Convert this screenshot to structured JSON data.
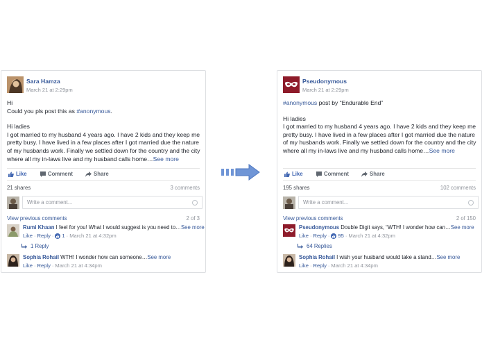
{
  "left_post": {
    "author": "Sara Hamza",
    "time": "March 21 at 2:29pm",
    "lines": [
      "Hi",
      "Could you pls post this as "
    ],
    "hashtag": "#anonymous",
    "period": ".",
    "greeting": "Hi ladies",
    "body": "I got married to my husband 4 years ago. I have 2 kids and they keep me pretty busy. I have lived in a few places after I got married due the nature of my husbands work. Finally we settled down for the country and the city where all my in-laws live and my husband calls home…",
    "see_more": "See more",
    "actions": {
      "like": "Like",
      "comment": "Comment",
      "share": "Share"
    },
    "shares": "21 shares",
    "comments_count": "3 comments",
    "comment_placeholder": "Write a comment...",
    "view_previous": "View previous comments",
    "page_count": "2 of 3",
    "comments": [
      {
        "author": "Rumi Khaan",
        "text": "I feel for you! What I would suggest is you need to…",
        "see_more": "See more",
        "like": "Like",
        "reply": "Reply",
        "likes": "1",
        "time": "March 21 at 4:32pm",
        "replies": "1 Reply"
      },
      {
        "author": "Sophia Rohail",
        "text": "WTH! I wonder how can someone…",
        "see_more": "See more",
        "like": "Like",
        "reply": "Reply",
        "time": "March 21 at 4:34pm"
      }
    ]
  },
  "right_post": {
    "author": "Pseudonymous",
    "time": "March 21 at 2:29pm",
    "hashtag": "#anonymous",
    "byline": " post by “Endurable End”",
    "greeting": "Hi ladies",
    "body": "I got married to my husband 4 years ago. I have 2 kids and they keep me pretty busy. I have lived in a few places after I got married due the nature of my husbands work. Finally we settled down for the country and the city where all my in-laws live and my husband calls home…",
    "see_more": "See more",
    "actions": {
      "like": "Like",
      "comment": "Comment",
      "share": "Share"
    },
    "shares": "195 shares",
    "comments_count": "102 comments",
    "comment_placeholder": "Write a comment...",
    "view_previous": "View previous comments",
    "page_count": "2 of 150",
    "comments": [
      {
        "author": "Pseudonymous",
        "text": "Double Digit says, “WTH! I wonder how can…",
        "see_more": "See more",
        "like": "Like",
        "reply": "Reply",
        "likes": "95",
        "time": "March 21 at 4:32pm",
        "replies": "64 Replies"
      },
      {
        "author": "Sophia Rohail",
        "text": "I wish your husband would take a stand…",
        "see_more": "See more",
        "like": "Like",
        "reply": "Reply",
        "time": "March 21 at 4:34pm"
      }
    ]
  },
  "colors": {
    "link": "#365899",
    "like_blue": "#4267b2",
    "arrow": "#6f95d6",
    "mask_bg": "#8e1b2a"
  },
  "icons": [
    "thumbs-up-icon",
    "comment-icon",
    "share-icon",
    "camera-icon",
    "reply-arrow-icon",
    "right-arrow-icon",
    "mask-icon"
  ]
}
